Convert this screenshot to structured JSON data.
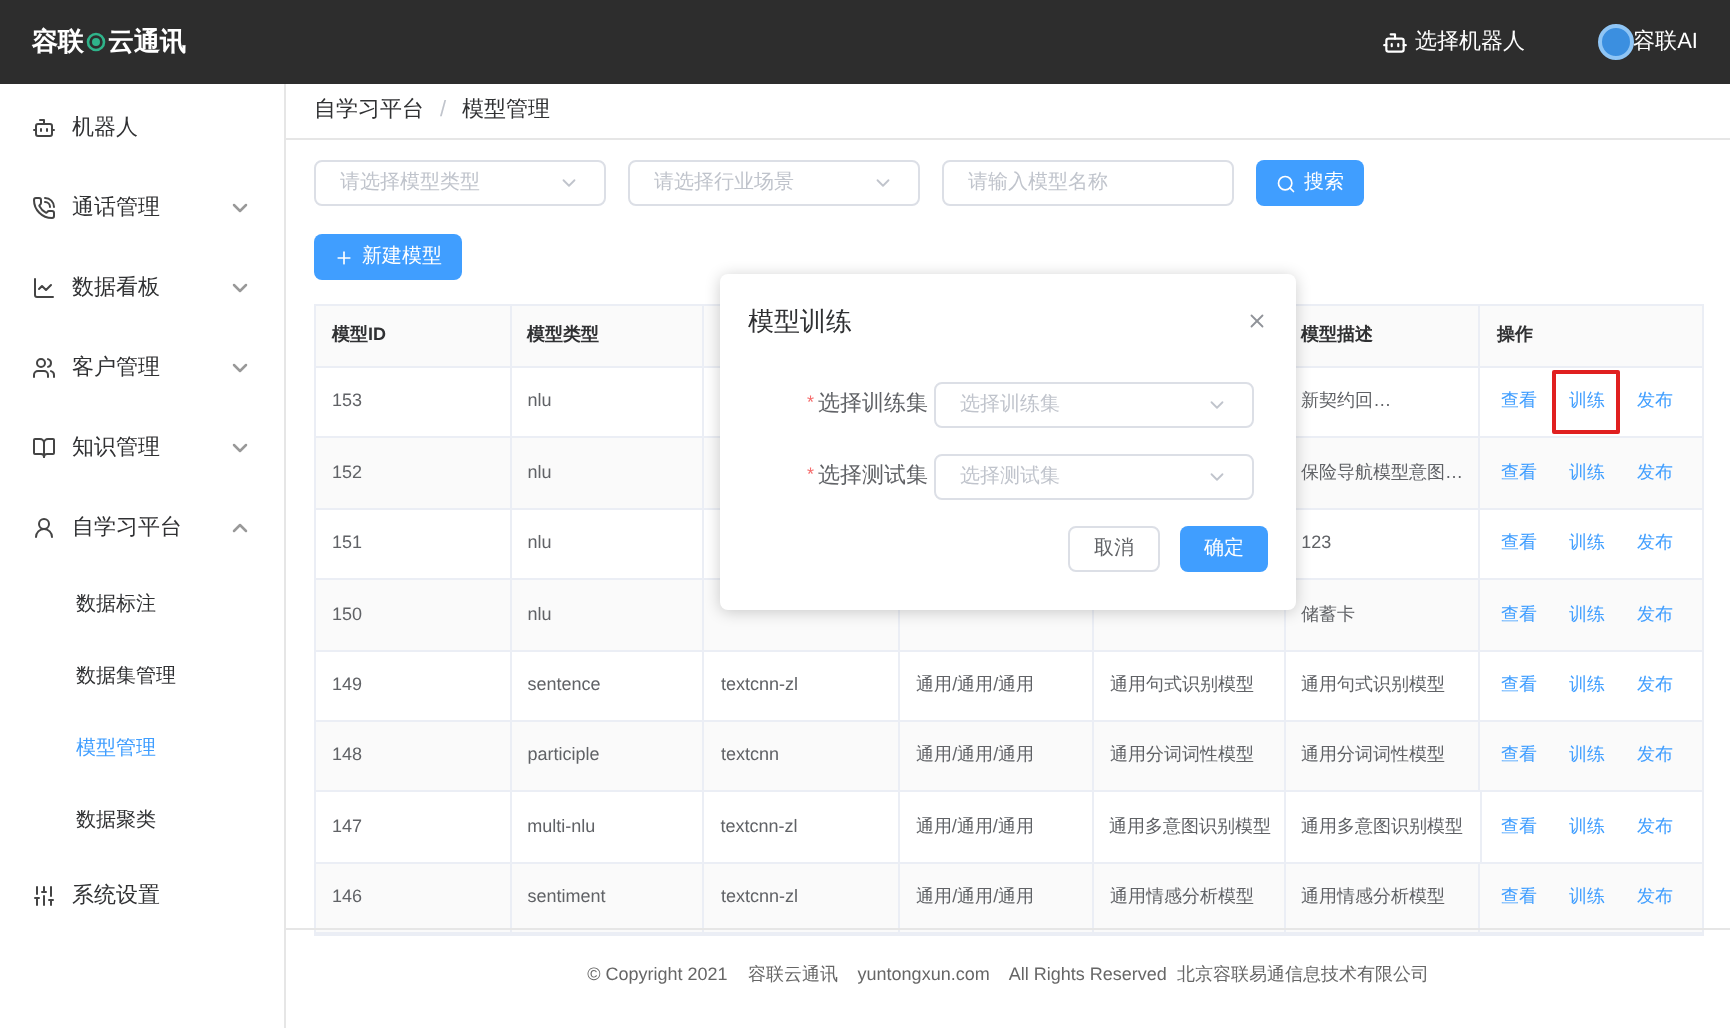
{
  "header": {
    "logo_left": "容联",
    "logo_right": "云通讯",
    "robot_select": "选择机器人",
    "user": "容联AI"
  },
  "sidebar": {
    "items": [
      {
        "label": "机器人",
        "kind": "link"
      },
      {
        "label": "通话管理",
        "kind": "group",
        "expanded": false
      },
      {
        "label": "数据看板",
        "kind": "group",
        "expanded": false
      },
      {
        "label": "客户管理",
        "kind": "group",
        "expanded": false
      },
      {
        "label": "知识管理",
        "kind": "group",
        "expanded": false
      },
      {
        "label": "自学习平台",
        "kind": "group",
        "expanded": true,
        "children": [
          {
            "label": "数据标注",
            "selected": false
          },
          {
            "label": "数据集管理",
            "selected": false
          },
          {
            "label": "模型管理",
            "selected": true
          },
          {
            "label": "数据聚类",
            "selected": false
          }
        ]
      },
      {
        "label": "系统设置",
        "kind": "link"
      }
    ]
  },
  "breadcrumb": {
    "items": [
      "自学习平台",
      "模型管理"
    ],
    "separator": "/"
  },
  "filters": {
    "model_type": {
      "placeholder": "请选择模型类型"
    },
    "scene": {
      "placeholder": "请选择行业场景"
    },
    "name": {
      "placeholder": "请输入模型名称"
    },
    "search_button": "搜索"
  },
  "new_button": "新建模型",
  "table": {
    "columns": [
      "模型ID",
      "模型类型",
      null,
      null,
      null,
      "模型描述",
      "操作"
    ],
    "rows": [
      {
        "cells": [
          "153",
          "nlu",
          null,
          null,
          null,
          "新契约回…"
        ],
        "actions": [
          {
            "label": "查看",
            "highlighted": false
          },
          {
            "label": "训练",
            "highlighted": true
          },
          {
            "label": "发布",
            "highlighted": false
          }
        ]
      },
      {
        "cells": [
          "152",
          "nlu",
          null,
          null,
          null,
          "保险导航模型意图…"
        ],
        "actions": [
          {
            "label": "查看",
            "highlighted": false
          },
          {
            "label": "训练",
            "highlighted": false
          },
          {
            "label": "发布",
            "highlighted": false
          }
        ]
      },
      {
        "cells": [
          "151",
          "nlu",
          null,
          null,
          null,
          "123"
        ],
        "actions": [
          {
            "label": "查看",
            "highlighted": false
          },
          {
            "label": "训练",
            "highlighted": false
          },
          {
            "label": "发布",
            "highlighted": false
          }
        ]
      },
      {
        "cells": [
          "150",
          "nlu",
          null,
          null,
          null,
          "储蓄卡"
        ],
        "actions": [
          {
            "label": "查看",
            "highlighted": false
          },
          {
            "label": "训练",
            "highlighted": false
          },
          {
            "label": "发布",
            "highlighted": false
          }
        ]
      },
      {
        "cells": [
          "149",
          "sentence",
          "textcnn-zl",
          "通用/通用/通用",
          "通用句式识别模型",
          "通用句式识别模型"
        ],
        "actions": [
          {
            "label": "查看",
            "highlighted": false
          },
          {
            "label": "训练",
            "highlighted": false
          },
          {
            "label": "发布",
            "highlighted": false
          }
        ]
      },
      {
        "cells": [
          "148",
          "participle",
          "textcnn",
          "通用/通用/通用",
          "通用分词词性模型",
          "通用分词词性模型"
        ],
        "actions": [
          {
            "label": "查看",
            "highlighted": false
          },
          {
            "label": "训练",
            "highlighted": false
          },
          {
            "label": "发布",
            "highlighted": false
          }
        ]
      },
      {
        "cells": [
          "147",
          "multi-nlu",
          "textcnn-zl",
          "通用/通用/通用",
          "通用多意图识别模型",
          "通用多意图识别模型"
        ],
        "actions": [
          {
            "label": "查看",
            "highlighted": false
          },
          {
            "label": "训练",
            "highlighted": false
          },
          {
            "label": "发布",
            "highlighted": false
          }
        ]
      },
      {
        "cells": [
          "146",
          "sentiment",
          "textcnn-zl",
          "通用/通用/通用",
          "通用情感分析模型",
          "通用情感分析模型"
        ],
        "actions": [
          {
            "label": "查看",
            "highlighted": false
          },
          {
            "label": "训练",
            "highlighted": false
          },
          {
            "label": "发布",
            "highlighted": false
          }
        ]
      }
    ]
  },
  "footer": "© Copyright 2021    容联云通讯    yuntongxun.com    All Rights Reserved  北京容联易通信息技术有限公司",
  "dialog": {
    "title": "模型训练",
    "fields": [
      {
        "label": "选择训练集",
        "required_mark": "*",
        "placeholder": "选择训练集"
      },
      {
        "label": "选择测试集",
        "required_mark": "*",
        "placeholder": "选择测试集"
      }
    ],
    "cancel": "取消",
    "confirm": "确定"
  }
}
